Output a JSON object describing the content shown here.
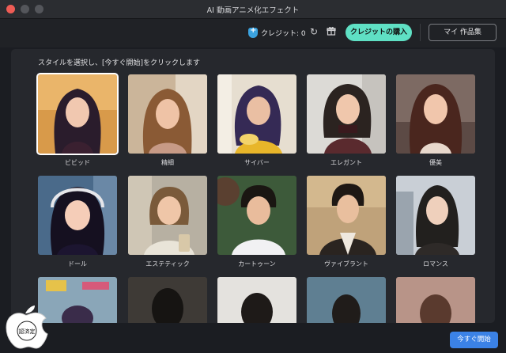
{
  "window": {
    "title": "AI 動画アニメ化エフェクト"
  },
  "toolbar": {
    "credit_label": "クレジット: 0",
    "credit_icon": "credit-shield-icon",
    "refresh_icon": "refresh-icon",
    "gift_icon": "gift-icon",
    "buy_credit_label": "クレジットの購入",
    "my_works_label": "マイ 作品集"
  },
  "main": {
    "instruction": "スタイルを選択し、[今すぐ開始]をクリックします",
    "styles": [
      {
        "label": "ビビッド",
        "selected": true
      },
      {
        "label": "精細",
        "selected": false
      },
      {
        "label": "サイバー",
        "selected": false
      },
      {
        "label": "エレガント",
        "selected": false
      },
      {
        "label": "優美",
        "selected": false
      },
      {
        "label": "ドール",
        "selected": false
      },
      {
        "label": "エステティック",
        "selected": false
      },
      {
        "label": "カートゥーン",
        "selected": false
      },
      {
        "label": "ヴァイブラント",
        "selected": false
      },
      {
        "label": "ロマンス",
        "selected": false
      }
    ]
  },
  "footer": {
    "start_label": "今すぐ開始"
  },
  "watermark": {
    "text": "認済定"
  },
  "colors": {
    "accent_teal": "#5fe0c4",
    "accent_blue": "#3b82e6",
    "background": "#1b1d22",
    "panel": "#26282d"
  }
}
